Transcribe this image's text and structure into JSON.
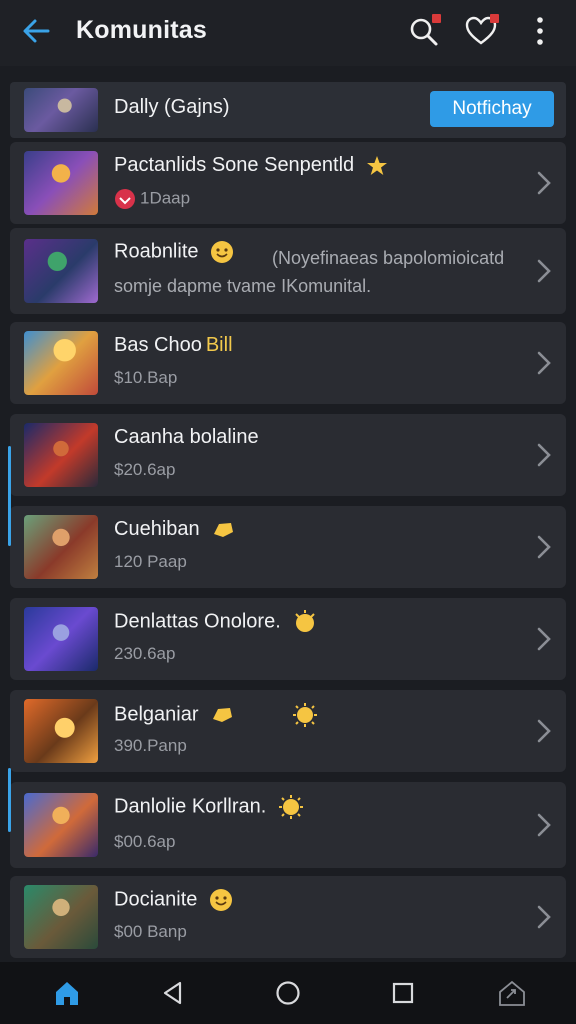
{
  "header": {
    "title": "Komunitas",
    "back_icon": "arrow-left-icon",
    "accent": "#3aa3e8"
  },
  "rows": [
    {
      "title": "Dally (Gajns)",
      "button": "Notfichay"
    },
    {
      "title": "Pactanlids Sone Senpentld",
      "sub": "1Daap"
    },
    {
      "title": "Roabnlite",
      "desc": "(Noyefinaeas bapolomioicatd",
      "desc2": "somje dapme tvame IKomunital."
    },
    {
      "title": "Bas Choo",
      "badge": "Bill",
      "sub": "$10.Bap"
    },
    {
      "title": "Caanha bolaline",
      "sub": "$20.6ap"
    },
    {
      "title": "Cuehiban",
      "sub": "120 Paap"
    },
    {
      "title": "Denlattas Onolore.",
      "sub": "230.6ap"
    },
    {
      "title": "Belganiar",
      "sub": "390.Panp"
    },
    {
      "title": "Danlolie Korllran.",
      "sub": "$00.6ap"
    },
    {
      "title": "Docianite",
      "sub": "$00 Banp"
    }
  ],
  "colors": {
    "background": "#1b1d22",
    "card": "#2a2c32",
    "button": "#2f9be6"
  }
}
